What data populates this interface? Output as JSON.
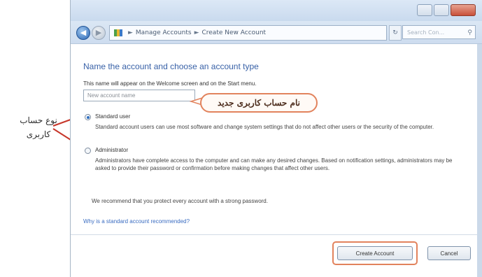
{
  "annotations": {
    "account_type_note_line1": "نوع حساب",
    "account_type_note_line2": "کاربری",
    "new_user_name_note": "نام حساب کاربری جدید"
  },
  "navbar": {
    "breadcrumb": [
      "Manage Accounts",
      "Create New Account"
    ],
    "search_placeholder": "Search Con..."
  },
  "page": {
    "heading": "Name the account and choose an account type",
    "subtext": "This name will appear on the Welcome screen and on the Start menu.",
    "name_placeholder": "New account name"
  },
  "options": [
    {
      "label": "Standard user",
      "selected": true,
      "description": "Standard account users can use most software and change system settings that do not affect other users or the security of the computer."
    },
    {
      "label": "Administrator",
      "selected": false,
      "description": "Administrators have complete access to the computer and can make any desired changes. Based on notification settings, administrators may be asked to provide their password or confirmation before making changes that affect other users."
    }
  ],
  "recommendation": "We recommend that you protect every account with a strong password.",
  "help_link": "Why is a standard account recommended?",
  "buttons": {
    "create": "Create Account",
    "cancel": "Cancel"
  },
  "colors": {
    "heading": "#3861a7",
    "annotation_border": "#e2835d",
    "link": "#3a6cc1"
  }
}
